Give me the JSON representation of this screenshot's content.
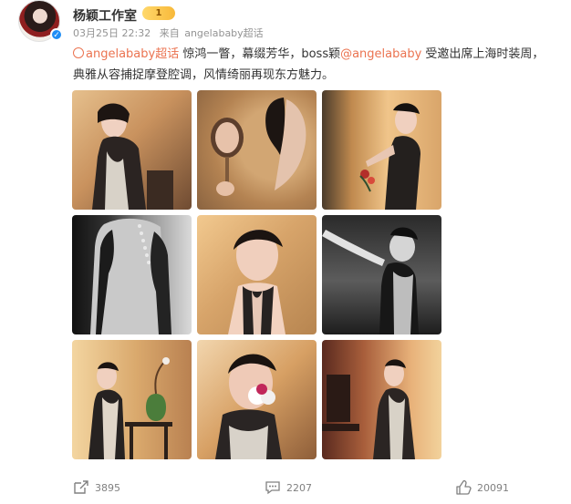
{
  "post": {
    "author": "杨颖工作室",
    "vip_level": "1",
    "timestamp": "03月25日 22:32",
    "source_prefix": "来自",
    "source": "angelababy超话",
    "text": {
      "topic": "angelababy超话",
      "part1": " 惊鸿一瞥，幕缀芳华，boss颖",
      "mention": "@angelababy",
      "part2": " 受邀出席上海时装周，",
      "line2": "典雅从容捕捉摩登腔调，风情绮丽再现东方魅力。"
    }
  },
  "footer": {
    "repost_count": "3895",
    "comment_count": "2207",
    "like_count": "20091"
  },
  "colors": {
    "link": "#eb7350",
    "verified": "#1f8df5",
    "meta": "#939393"
  },
  "icons": {
    "repost": "share-icon",
    "comment": "comment-icon",
    "like": "thumbs-up-icon",
    "verified": "verified-badge-icon",
    "topic": "topic-icon"
  }
}
